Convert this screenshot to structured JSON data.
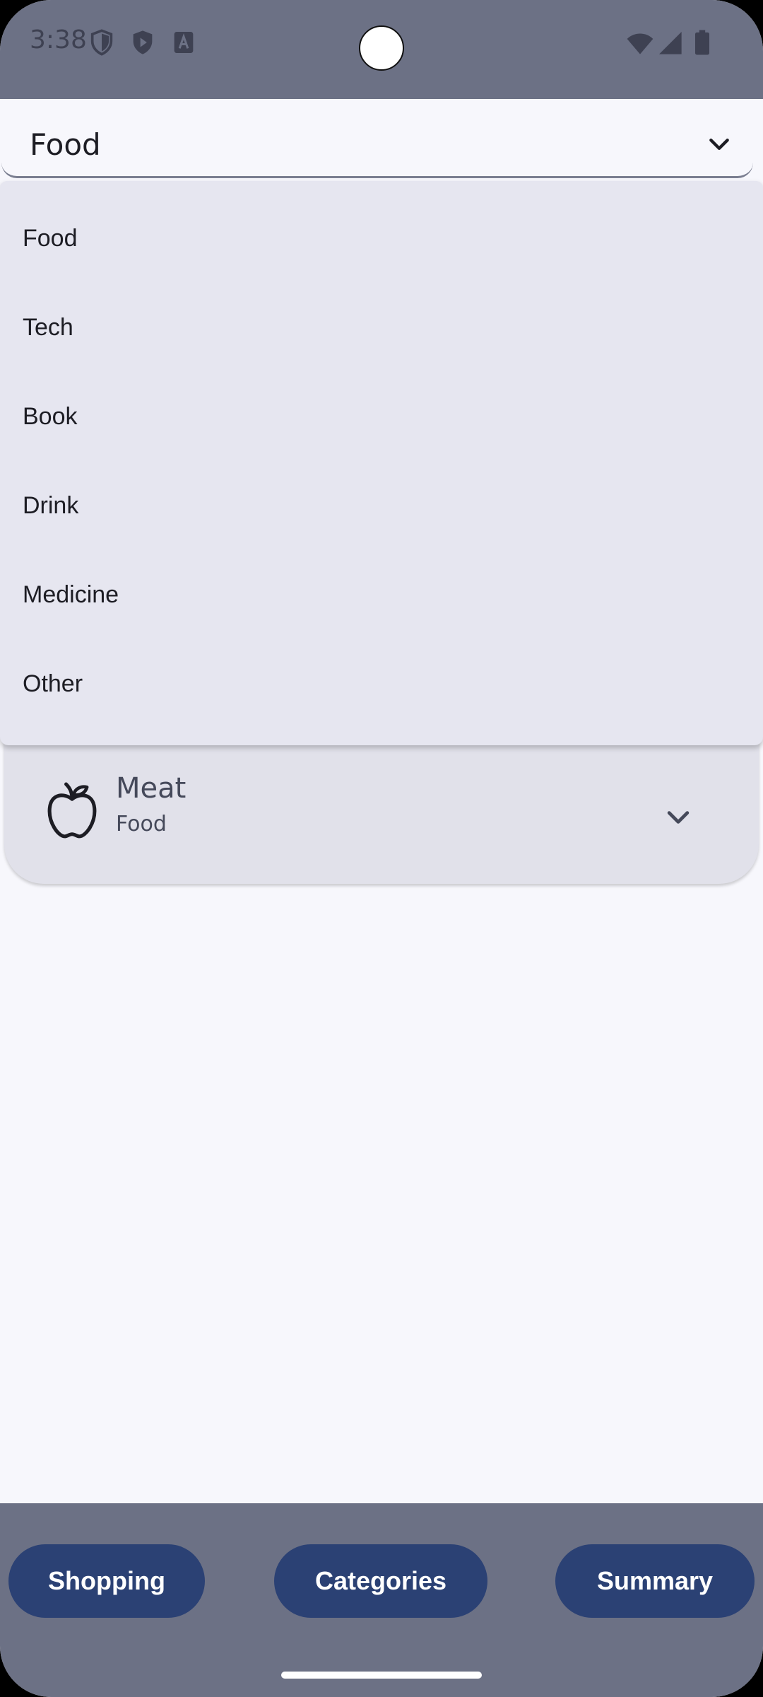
{
  "status_bar": {
    "time": "3:38",
    "icons": [
      "shield-icon",
      "play-protect-icon",
      "keyboard-a-icon",
      "wifi-icon",
      "cellular-icon",
      "battery-icon"
    ]
  },
  "category_dropdown": {
    "selected": "Food",
    "options": [
      "Food",
      "Tech",
      "Book",
      "Drink",
      "Medicine",
      "Other"
    ]
  },
  "item_card": {
    "name": "Meat",
    "category": "Food",
    "icon": "apple-icon"
  },
  "bottom_nav": {
    "shopping": "Shopping",
    "categories": "Categories",
    "summary": "Summary"
  },
  "colors": {
    "scrim": "#6c7185",
    "background": "#f7f7fc",
    "menu": "#e6e6f0",
    "card": "#e1e1ea",
    "nav_button": "#2b4174"
  }
}
